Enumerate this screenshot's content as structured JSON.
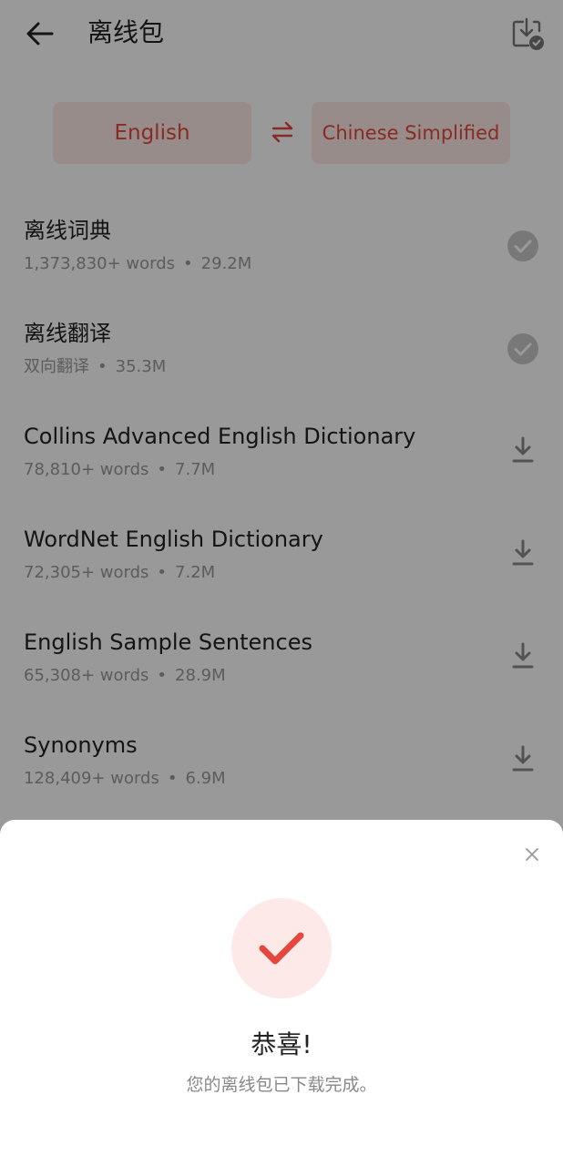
{
  "header": {
    "title": "离线包",
    "back_icon": "arrow-left-icon",
    "download_manager_icon": "download-check-icon"
  },
  "languages": {
    "source": "English",
    "target": "Chinese Simplified",
    "swap_icon": "swap-arrows-icon"
  },
  "packs": [
    {
      "name": "离线词典",
      "count": "1,373,830+ words",
      "size": "29.2M",
      "state": "downloaded"
    },
    {
      "name": "离线翻译",
      "count": "双向翻译",
      "size": "35.3M",
      "state": "downloaded"
    },
    {
      "name": "Collins Advanced English Dictionary",
      "count": "78,810+ words",
      "size": "7.7M",
      "state": "download"
    },
    {
      "name": "WordNet English Dictionary",
      "count": "72,305+ words",
      "size": "7.2M",
      "state": "download"
    },
    {
      "name": "English Sample Sentences",
      "count": "65,308+ words",
      "size": "28.9M",
      "state": "download"
    },
    {
      "name": "Synonyms",
      "count": "128,409+ words",
      "size": "6.9M",
      "state": "download"
    }
  ],
  "meta_separator": "•",
  "dialog": {
    "title": "恭喜!",
    "message": "您的离线包已下载完成。",
    "close_icon": "close-icon",
    "success_icon": "checkmark-icon"
  },
  "colors": {
    "accent": "#e5473d",
    "accent_bg": "#fde9e7",
    "downloaded_icon": "#c9c9c9",
    "download_icon": "#8a8a8a"
  }
}
